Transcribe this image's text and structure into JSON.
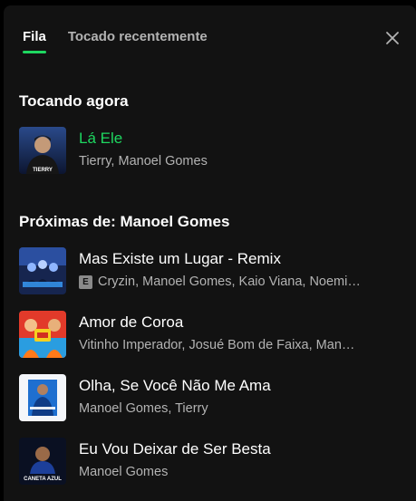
{
  "tabs": [
    {
      "label": "Fila",
      "active": true
    },
    {
      "label": "Tocado recentemente",
      "active": false
    }
  ],
  "now_playing": {
    "heading": "Tocando agora",
    "title": "Lá Ele",
    "artists": "Tierry, Manoel Gomes",
    "art_caption": "TIERRY"
  },
  "next": {
    "heading": "Próximas de: Manoel Gomes",
    "tracks": [
      {
        "title": "Mas Existe um Lugar - Remix",
        "explicit_label": "E",
        "artists": "Cryzin, Manoel Gomes, Kaio Viana, Noemi…"
      },
      {
        "title": "Amor de Coroa",
        "artists": "Vitinho Imperador, Josué Bom de Faixa, Man…"
      },
      {
        "title": "Olha, Se Você Não Me Ama",
        "artists": "Manoel Gomes, Tierry"
      },
      {
        "title": "Eu Vou Deixar de Ser Besta",
        "artists": "Manoel Gomes",
        "art_caption": "CANETA AZUL"
      }
    ]
  },
  "colors": {
    "background": "#121212",
    "accent": "#1ed760",
    "text_primary": "#ffffff",
    "text_secondary": "#b3b3b3"
  },
  "icons": {
    "close": "close-icon",
    "explicit": "explicit-icon"
  }
}
